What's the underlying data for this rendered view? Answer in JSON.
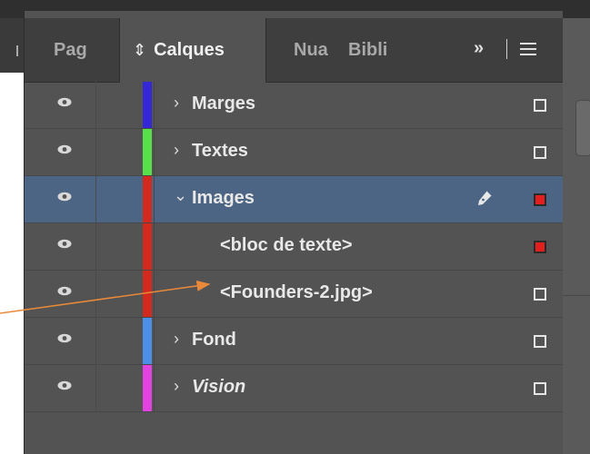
{
  "panel": {
    "tabs": [
      {
        "label": "Pag"
      },
      {
        "label": "Calques",
        "indicator": "⇕"
      },
      {
        "label": "Nua"
      },
      {
        "label": "Bibli"
      }
    ],
    "overflow_glyph": "»",
    "colors": {
      "background": "#535353",
      "tabbar": "#3e3e3e",
      "selected_row": "#4c6584",
      "annotation_arrow": "#e98a3a"
    }
  },
  "layers": [
    {
      "name": "Marges",
      "color": "#3427d6",
      "expanded": false,
      "visible": true
    },
    {
      "name": "Textes",
      "color": "#58e04a",
      "expanded": false,
      "visible": true
    },
    {
      "name": "Images",
      "color": "#d32a1f",
      "expanded": true,
      "visible": true,
      "selected": true,
      "target_layer": true
    },
    {
      "name": "<bloc de texte>",
      "color": "#d32a1f",
      "child": true,
      "visible": true,
      "object_selected": true
    },
    {
      "name": "<Founders-2.jpg>",
      "color": "#d32a1f",
      "child": true,
      "visible": true
    },
    {
      "name": "Fond",
      "color": "#4c8fe8",
      "expanded": false,
      "visible": true
    },
    {
      "name": "Vision",
      "color": "#e142e0",
      "expanded": false,
      "visible": true,
      "italic": true
    }
  ]
}
